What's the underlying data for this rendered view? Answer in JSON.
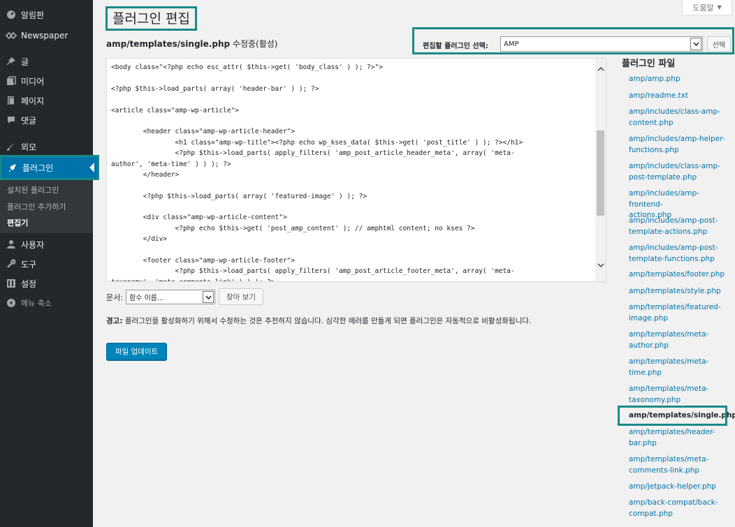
{
  "sidebar": {
    "menu": [
      {
        "label": "알림판",
        "icon": "dashboard-icon"
      },
      {
        "label": "Newspaper",
        "icon": "newspaper-icon"
      },
      {
        "label": "글",
        "icon": "pin-icon"
      },
      {
        "label": "미디어",
        "icon": "media-icon"
      },
      {
        "label": "페이지",
        "icon": "page-icon"
      },
      {
        "label": "댓글",
        "icon": "comment-icon"
      },
      {
        "label": "외모",
        "icon": "appearance-icon"
      },
      {
        "label": "플러그인",
        "icon": "plugin-icon"
      },
      {
        "label": "사용자",
        "icon": "user-icon"
      },
      {
        "label": "도구",
        "icon": "tools-icon"
      },
      {
        "label": "설정",
        "icon": "settings-icon"
      },
      {
        "label": "메뉴 축소",
        "icon": "collapse-icon"
      }
    ],
    "submenu": [
      "설치된 플러그인",
      "플러그인 추가하기",
      "편집기"
    ]
  },
  "header": {
    "title": "플러그인 편집",
    "help": "도움말",
    "file_name": "amp/templates/single.php",
    "file_status": "수정중(활성)"
  },
  "plugin_select": {
    "label": "편집할 플러그인 선택:",
    "value": "AMP",
    "button": "선택"
  },
  "editor": {
    "lines": [
      "<body class=\"<?php echo esc_attr( $this->get( 'body_class' ) ); ?>\">",
      "",
      "<?php $this->load_parts( array( 'header-bar' ) ); ?>",
      "",
      "<article class=\"amp-wp-article\">",
      "",
      "        <header class=\"amp-wp-article-header\">",
      "                <h1 class=\"amp-wp-title\"><?php echo wp_kses_data( $this->get( 'post_title' ) ); ?></h1>",
      "                <?php $this->load_parts( apply_filters( 'amp_post_article_header_meta', array( 'meta-",
      "author', 'meta-time' ) ) ); ?>",
      "        </header>",
      "",
      "        <?php $this->load_parts( array( 'featured-image' ) ); ?>",
      "",
      "        <div class=\"amp-wp-article-content\">",
      "                <?php echo $this->get( 'post_amp_content' ); // amphtml content; no kses ?>",
      "        </div>",
      "",
      "        <footer class=\"amp-wp-article-footer\">",
      "                <?php $this->load_parts( apply_filters( 'amp_post_article_footer_meta', array( 'meta-",
      "taxonomy', 'meta-comments-link' ) ) ); ?>"
    ]
  },
  "documentation": {
    "label": "문서:",
    "select_value": "함수 이름...",
    "button": "찾아 보기"
  },
  "warning": {
    "bold": "경고:",
    "text": " 플러그인을 활성화하기 위해서 수정하는 것은 추천하지 않습니다. 심각한 에러를 만들게 되면 플러그인은 자동적으로 비활성화됩니다."
  },
  "update_button": "파일 업데이트",
  "plugin_files": {
    "heading": "플러그인 파일",
    "files": [
      [
        "amp/amp.php"
      ],
      [
        "amp/readme.txt"
      ],
      [
        "amp/includes/class-amp-",
        "content.php"
      ],
      [
        "amp/includes/amp-helper-",
        "functions.php"
      ],
      [
        "amp/includes/class-amp-",
        "post-template.php"
      ],
      [
        "amp/includes/amp-frontend-",
        "actions.php"
      ],
      [
        "amp/includes/amp-post-",
        "template-actions.php"
      ],
      [
        "amp/includes/amp-post-",
        "template-functions.php"
      ],
      [
        "amp/templates/footer.php"
      ],
      [
        "amp/templates/style.php"
      ],
      [
        "amp/templates/featured-",
        "image.php"
      ],
      [
        "amp/templates/meta-",
        "author.php"
      ],
      [
        "amp/templates/meta-",
        "time.php"
      ],
      [
        "amp/templates/meta-",
        "taxonomy.php"
      ],
      [
        "amp/templates/single.php"
      ],
      [
        "amp/templates/header-",
        "bar.php"
      ],
      [
        "amp/templates/meta-",
        "comments-link.php"
      ],
      [
        "amp/jetpack-helper.php"
      ],
      [
        "amp/back-compat/back-",
        "compat.php"
      ]
    ],
    "current_index": 14
  }
}
